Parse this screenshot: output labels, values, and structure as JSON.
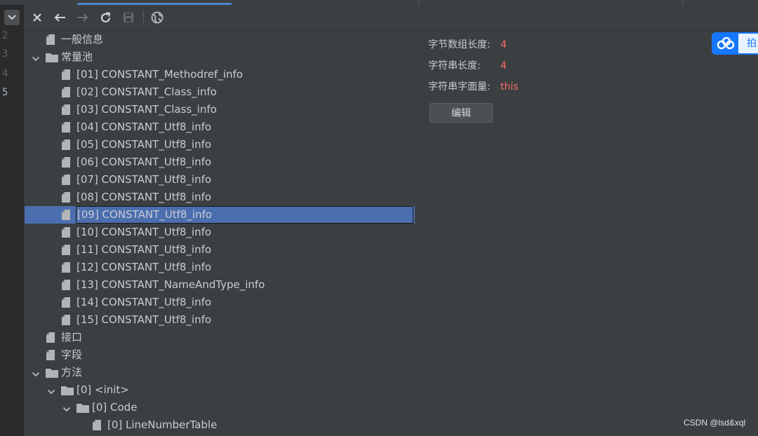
{
  "gutter": {
    "line_numbers": [
      "2",
      "3",
      "4",
      "5"
    ]
  },
  "tree": {
    "items": [
      {
        "label": "一般信息",
        "depth": 0,
        "kind": "file"
      },
      {
        "label": "常量池",
        "depth": 0,
        "kind": "folder",
        "expanded": true
      },
      {
        "label": "[01] CONSTANT_Methodref_info",
        "depth": 1,
        "kind": "file"
      },
      {
        "label": "[02] CONSTANT_Class_info",
        "depth": 1,
        "kind": "file"
      },
      {
        "label": "[03] CONSTANT_Class_info",
        "depth": 1,
        "kind": "file"
      },
      {
        "label": "[04] CONSTANT_Utf8_info",
        "depth": 1,
        "kind": "file"
      },
      {
        "label": "[05] CONSTANT_Utf8_info",
        "depth": 1,
        "kind": "file"
      },
      {
        "label": "[06] CONSTANT_Utf8_info",
        "depth": 1,
        "kind": "file"
      },
      {
        "label": "[07] CONSTANT_Utf8_info",
        "depth": 1,
        "kind": "file"
      },
      {
        "label": "[08] CONSTANT_Utf8_info",
        "depth": 1,
        "kind": "file"
      },
      {
        "label": "[09] CONSTANT_Utf8_info",
        "depth": 1,
        "kind": "file",
        "selected": true
      },
      {
        "label": "[10] CONSTANT_Utf8_info",
        "depth": 1,
        "kind": "file"
      },
      {
        "label": "[11] CONSTANT_Utf8_info",
        "depth": 1,
        "kind": "file"
      },
      {
        "label": "[12] CONSTANT_Utf8_info",
        "depth": 1,
        "kind": "file"
      },
      {
        "label": "[13] CONSTANT_NameAndType_info",
        "depth": 1,
        "kind": "file"
      },
      {
        "label": "[14] CONSTANT_Utf8_info",
        "depth": 1,
        "kind": "file"
      },
      {
        "label": "[15] CONSTANT_Utf8_info",
        "depth": 1,
        "kind": "file"
      },
      {
        "label": "接口",
        "depth": 0,
        "kind": "file"
      },
      {
        "label": "字段",
        "depth": 0,
        "kind": "file"
      },
      {
        "label": "方法",
        "depth": 0,
        "kind": "folder",
        "expanded": true
      },
      {
        "label": "[0] <init>",
        "depth": 1,
        "kind": "folder",
        "expanded": true
      },
      {
        "label": "[0] Code",
        "depth": 2,
        "kind": "folder",
        "expanded": true
      },
      {
        "label": "[0] LineNumberTable",
        "depth": 3,
        "kind": "file"
      }
    ]
  },
  "detail": {
    "byte_length_label": "字节数组长度:",
    "byte_length_value": "4",
    "string_length_label": "字符串长度:",
    "string_length_value": "4",
    "literal_label": "字符串字面量:",
    "literal_value": "this",
    "edit_label": "编辑"
  },
  "overlay": {
    "cloud_text": "拍",
    "watermark": "CSDN @lsd&xql"
  },
  "colors": {
    "selection": "#4b6eaf",
    "value_red": "#ff6b68",
    "panel": "#3c3f41"
  },
  "icons": [
    "close-icon",
    "back-arrow-icon",
    "forward-arrow-icon",
    "refresh-icon",
    "save-icon",
    "globe-icon",
    "chevron-down-icon",
    "file-icon",
    "folder-icon",
    "cloud-icon"
  ]
}
